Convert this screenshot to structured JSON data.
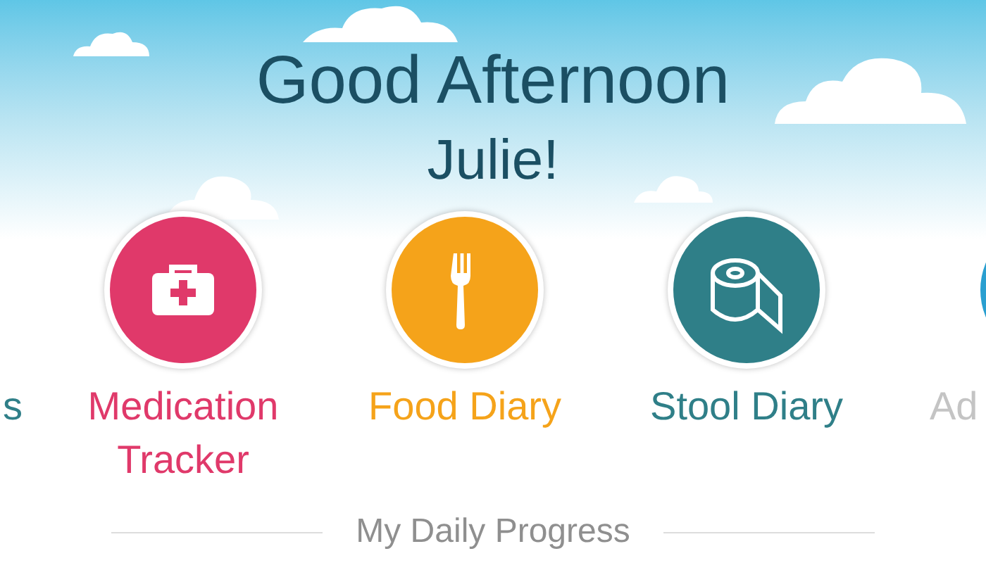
{
  "greeting": {
    "line_1": "Good Afternoon",
    "line_2": "Julie!"
  },
  "trackers": [
    {
      "kind": "cut-left",
      "label_lines": [
        "s"
      ],
      "color": "#2f7f88"
    },
    {
      "kind": "medication",
      "label_lines": [
        "Medication",
        "Tracker"
      ],
      "color": "#e0396a"
    },
    {
      "kind": "food",
      "label_lines": [
        "Food Diary"
      ],
      "color": "#f5a31a"
    },
    {
      "kind": "stool",
      "label_lines": [
        "Stool Diary"
      ],
      "color": "#2f7f88"
    },
    {
      "kind": "cut-right",
      "label_lines": [
        "Ad"
      ],
      "color": "#2a9fd0",
      "disabled": true
    }
  ],
  "section_title": "My Daily Progress"
}
